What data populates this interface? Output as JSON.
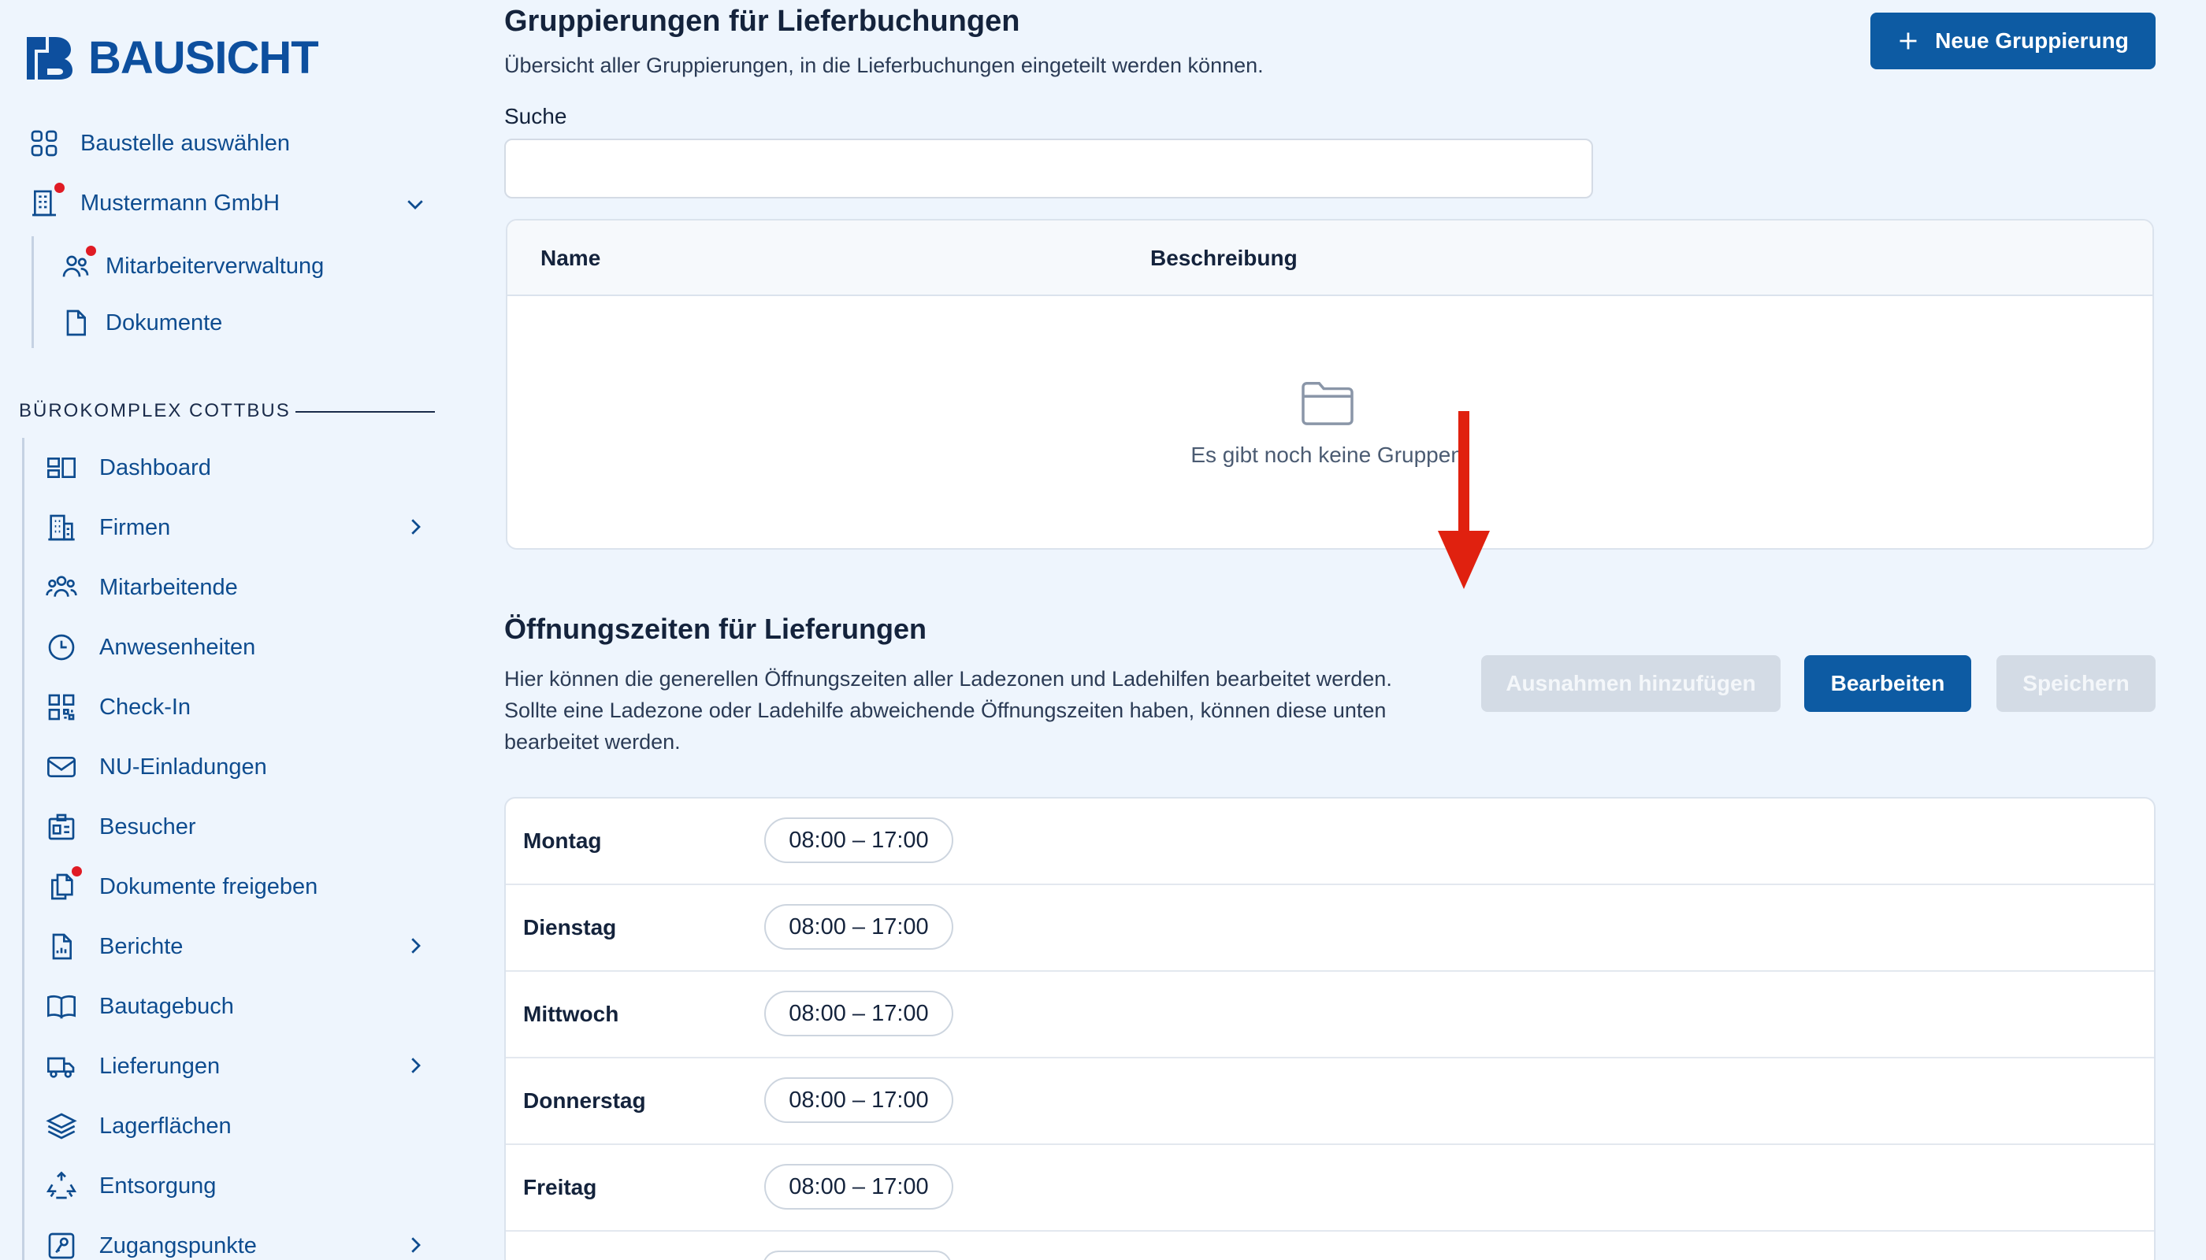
{
  "brand": {
    "name": "BAUSICHT",
    "color": "#0d4f9e"
  },
  "nav_top": [
    {
      "label": "Baustelle auswählen",
      "icon": "grid-icon"
    },
    {
      "label": "Mustermann GmbH",
      "icon": "building-icon"
    }
  ],
  "nav_company": [
    {
      "label": "Mitarbeiterverwaltung",
      "icon": "users-icon"
    },
    {
      "label": "Dokumente",
      "icon": "document-icon"
    }
  ],
  "section": {
    "title": "BÜROKOMPLEX COTTBUS"
  },
  "nav_site": [
    {
      "label": "Dashboard",
      "icon": "dashboard-icon"
    },
    {
      "label": "Firmen",
      "icon": "office-building-icon"
    },
    {
      "label": "Mitarbeitende",
      "icon": "user-group-icon"
    },
    {
      "label": "Anwesenheiten",
      "icon": "clock-icon"
    },
    {
      "label": "Check-In",
      "icon": "qr-code-icon"
    },
    {
      "label": "NU-Einladungen",
      "icon": "envelope-icon"
    },
    {
      "label": "Besucher",
      "icon": "id-card-icon"
    },
    {
      "label": "Dokumente freigeben",
      "icon": "documents-icon"
    },
    {
      "label": "Berichte",
      "icon": "report-icon"
    },
    {
      "label": "Bautagebuch",
      "icon": "book-icon"
    },
    {
      "label": "Lieferungen",
      "icon": "truck-icon"
    },
    {
      "label": "Lagerflächen",
      "icon": "layers-icon"
    },
    {
      "label": "Entsorgung",
      "icon": "recycle-icon"
    },
    {
      "label": "Zugangspunkte",
      "icon": "key-icon"
    }
  ],
  "groups": {
    "title": "Gruppierungen für Lieferbuchungen",
    "subtitle": "Übersicht aller Gruppierungen, in die Lieferbuchungen eingeteilt werden können.",
    "new_button": "Neue Gruppierung",
    "search_label": "Suche",
    "search_value": "",
    "columns": [
      "Name",
      "Beschreibung"
    ],
    "empty_text": "Es gibt noch keine Gruppen."
  },
  "hours": {
    "title": "Öffnungszeiten für Lieferungen",
    "description": "Hier können die generellen Öffnungszeiten aller Ladezonen und Ladehilfen bearbeitet werden. Sollte eine Ladezone oder Ladehilfe abweichende Öffnungszeiten haben, können diese unten bearbeitet werden.",
    "btn_exceptions": "Ausnahmen hinzufügen",
    "btn_edit": "Bearbeiten",
    "btn_save": "Speichern",
    "rows": [
      {
        "day": "Montag",
        "time": "08:00 – 17:00"
      },
      {
        "day": "Dienstag",
        "time": "08:00 – 17:00"
      },
      {
        "day": "Mittwoch",
        "time": "08:00 – 17:00"
      },
      {
        "day": "Donnerstag",
        "time": "08:00 – 17:00"
      },
      {
        "day": "Freitag",
        "time": "08:00 – 17:00"
      }
    ]
  },
  "colors": {
    "primary": "#0d5ba3",
    "nav_text": "#0e4c8f",
    "notification": "#e01b24",
    "annotation_arrow": "#e0210f"
  }
}
